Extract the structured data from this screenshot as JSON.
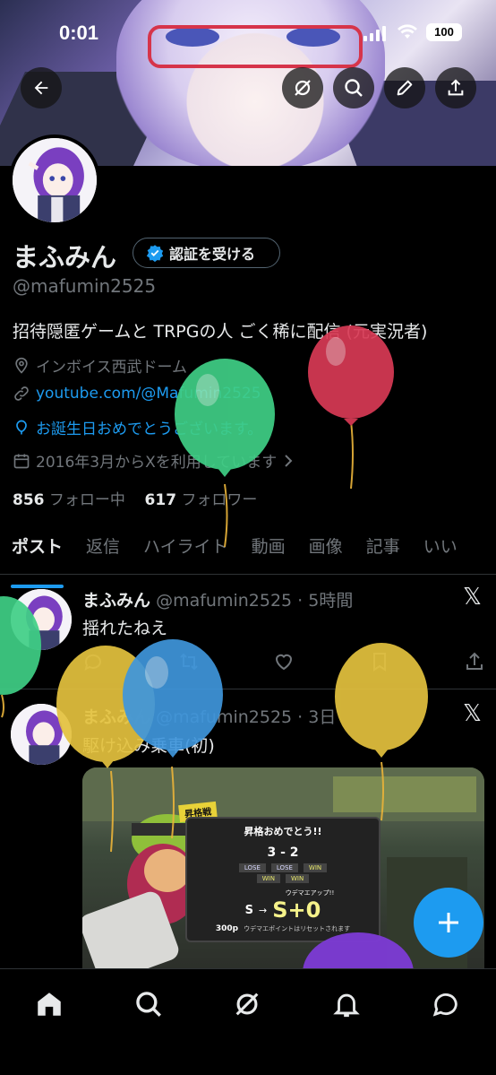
{
  "status_bar": {
    "time": "0:01",
    "battery": "100"
  },
  "profile": {
    "name": "まふみん",
    "verify_label": "認証を受ける",
    "handle": "@mafumin2525",
    "bio": "招待隠匿ゲームと TRPGの人 ごく稀に配信 (元実況者)",
    "location": "インボイス西武ドーム",
    "link": "youtube.com/@Mafumin2525",
    "birthday": "お誕生日おめでとうございます。",
    "joined": "2016年3月からXを利用しています",
    "following_count": "856",
    "following_label": "フォロー中",
    "followers_count": "617",
    "followers_label": "フォロワー"
  },
  "tabs": [
    {
      "label": "ポスト",
      "active": true
    },
    {
      "label": "返信",
      "active": false
    },
    {
      "label": "ハイライト",
      "active": false
    },
    {
      "label": "動画",
      "active": false
    },
    {
      "label": "画像",
      "active": false
    },
    {
      "label": "記事",
      "active": false
    },
    {
      "label": "いい",
      "active": false
    }
  ],
  "posts": [
    {
      "name": "まふみん",
      "meta": "@mafumin2525 · 5時間",
      "text": "揺れたねえ"
    },
    {
      "name": "まふみん",
      "meta": "@mafumin2525 · 3日",
      "text": "駆け込み乗車(初)"
    }
  ],
  "game_screen": {
    "badge": "昇格戦",
    "headline": "昇格おめでとう!!",
    "score": "3 - 2",
    "row1": [
      "LOSE",
      "LOSE",
      "WIN"
    ],
    "row2": [
      "WIN",
      "WIN"
    ],
    "rank_label": "ウデマエアップ!!",
    "rank_from": "S",
    "rank_to": "S+0",
    "points": "300p",
    "points_note": "ウデマエポイントはリセットされます"
  },
  "icons": [
    "back-arrow-icon",
    "grok-icon",
    "search-icon",
    "edit-icon",
    "share-icon",
    "verified-badge-icon",
    "location-icon",
    "link-icon",
    "balloon-icon",
    "calendar-icon",
    "chevron-right-icon",
    "x-logo-icon",
    "reply-icon",
    "repost-icon",
    "like-icon",
    "bookmark-icon",
    "compose-plus-icon",
    "home-icon",
    "explore-icon",
    "notifications-icon",
    "messages-icon"
  ],
  "colors": {
    "accent": "#1d9bf0",
    "background": "#000000",
    "muted": "#71767b",
    "text": "#e7e9ea"
  }
}
